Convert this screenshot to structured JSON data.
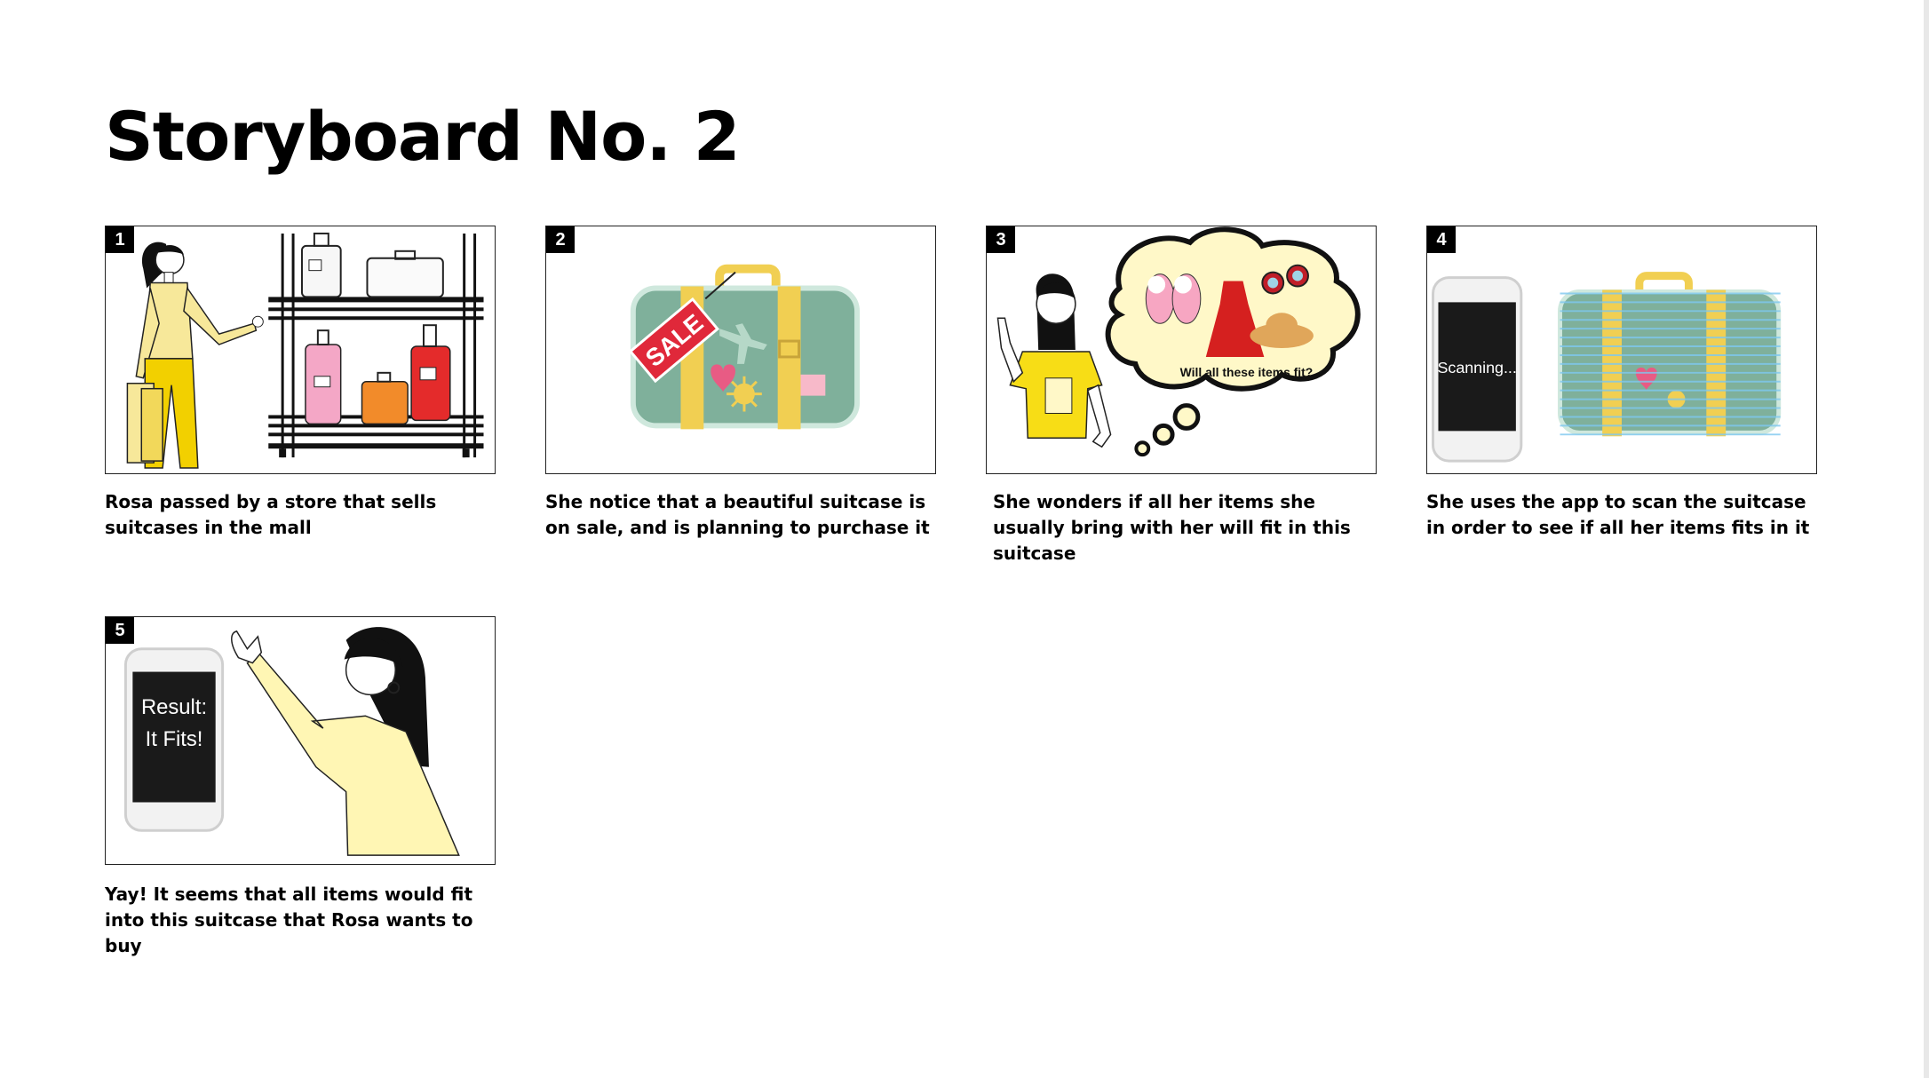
{
  "title": "Storyboard No. 2",
  "panels": [
    {
      "number": "1",
      "caption": "Rosa passed by a store that sells suitcases in the mall"
    },
    {
      "number": "2",
      "caption": "She notice that a beautiful suitcase is on sale, and is planning to purchase it",
      "tag_text": "SALE"
    },
    {
      "number": "3",
      "caption": "She wonders if all her items she usually bring with her will fit in this suitcase",
      "bubble_text": "Will all these items fit?"
    },
    {
      "number": "4",
      "caption": "She uses the app to scan the suitcase in order to see if all her items fits in it",
      "phone_text": "Scanning..."
    },
    {
      "number": "5",
      "caption": "Yay! It seems that all items would fit into this suitcase that Rosa wants to buy",
      "phone_line1": "Result:",
      "phone_line2": "It Fits!"
    }
  ],
  "colors": {
    "yellow": "#f7e89a",
    "suitcase_green": "#7fb09b",
    "strap_yellow": "#f1cf52",
    "sale_red": "#e0283a"
  }
}
